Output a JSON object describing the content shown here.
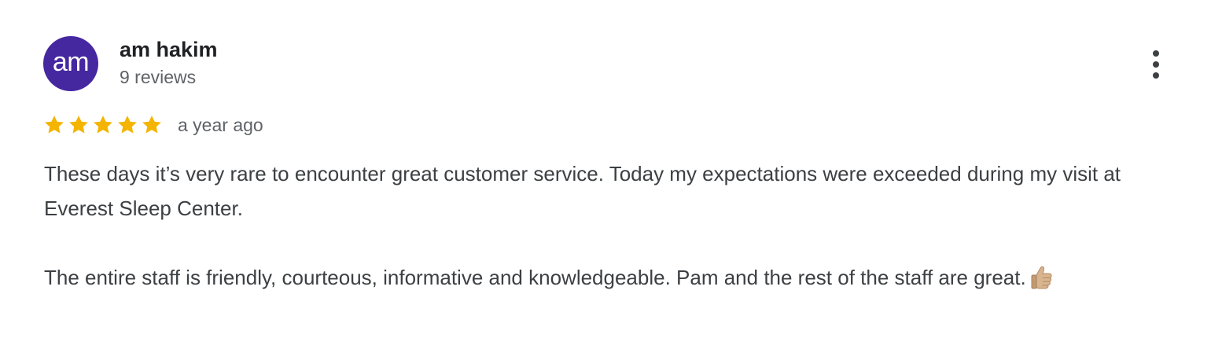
{
  "author": {
    "avatar_initials": "am",
    "avatar_color": "#4527a0",
    "name": "am hakim",
    "meta": "9 reviews"
  },
  "review": {
    "rating": 5,
    "rating_max": 5,
    "star_color": "#f4b400",
    "date": "a year ago",
    "paragraphs": [
      "These days it’s very rare to encounter great customer service. Today my expectations were exceeded during my visit at Everest Sleep Center.",
      "The entire staff is friendly, courteous, informative and knowledgeable. Pam and the rest of the staff are great."
    ],
    "trailing_icon": "thumbs-up-icon"
  },
  "menu": {
    "icon": "more-vertical-icon"
  }
}
